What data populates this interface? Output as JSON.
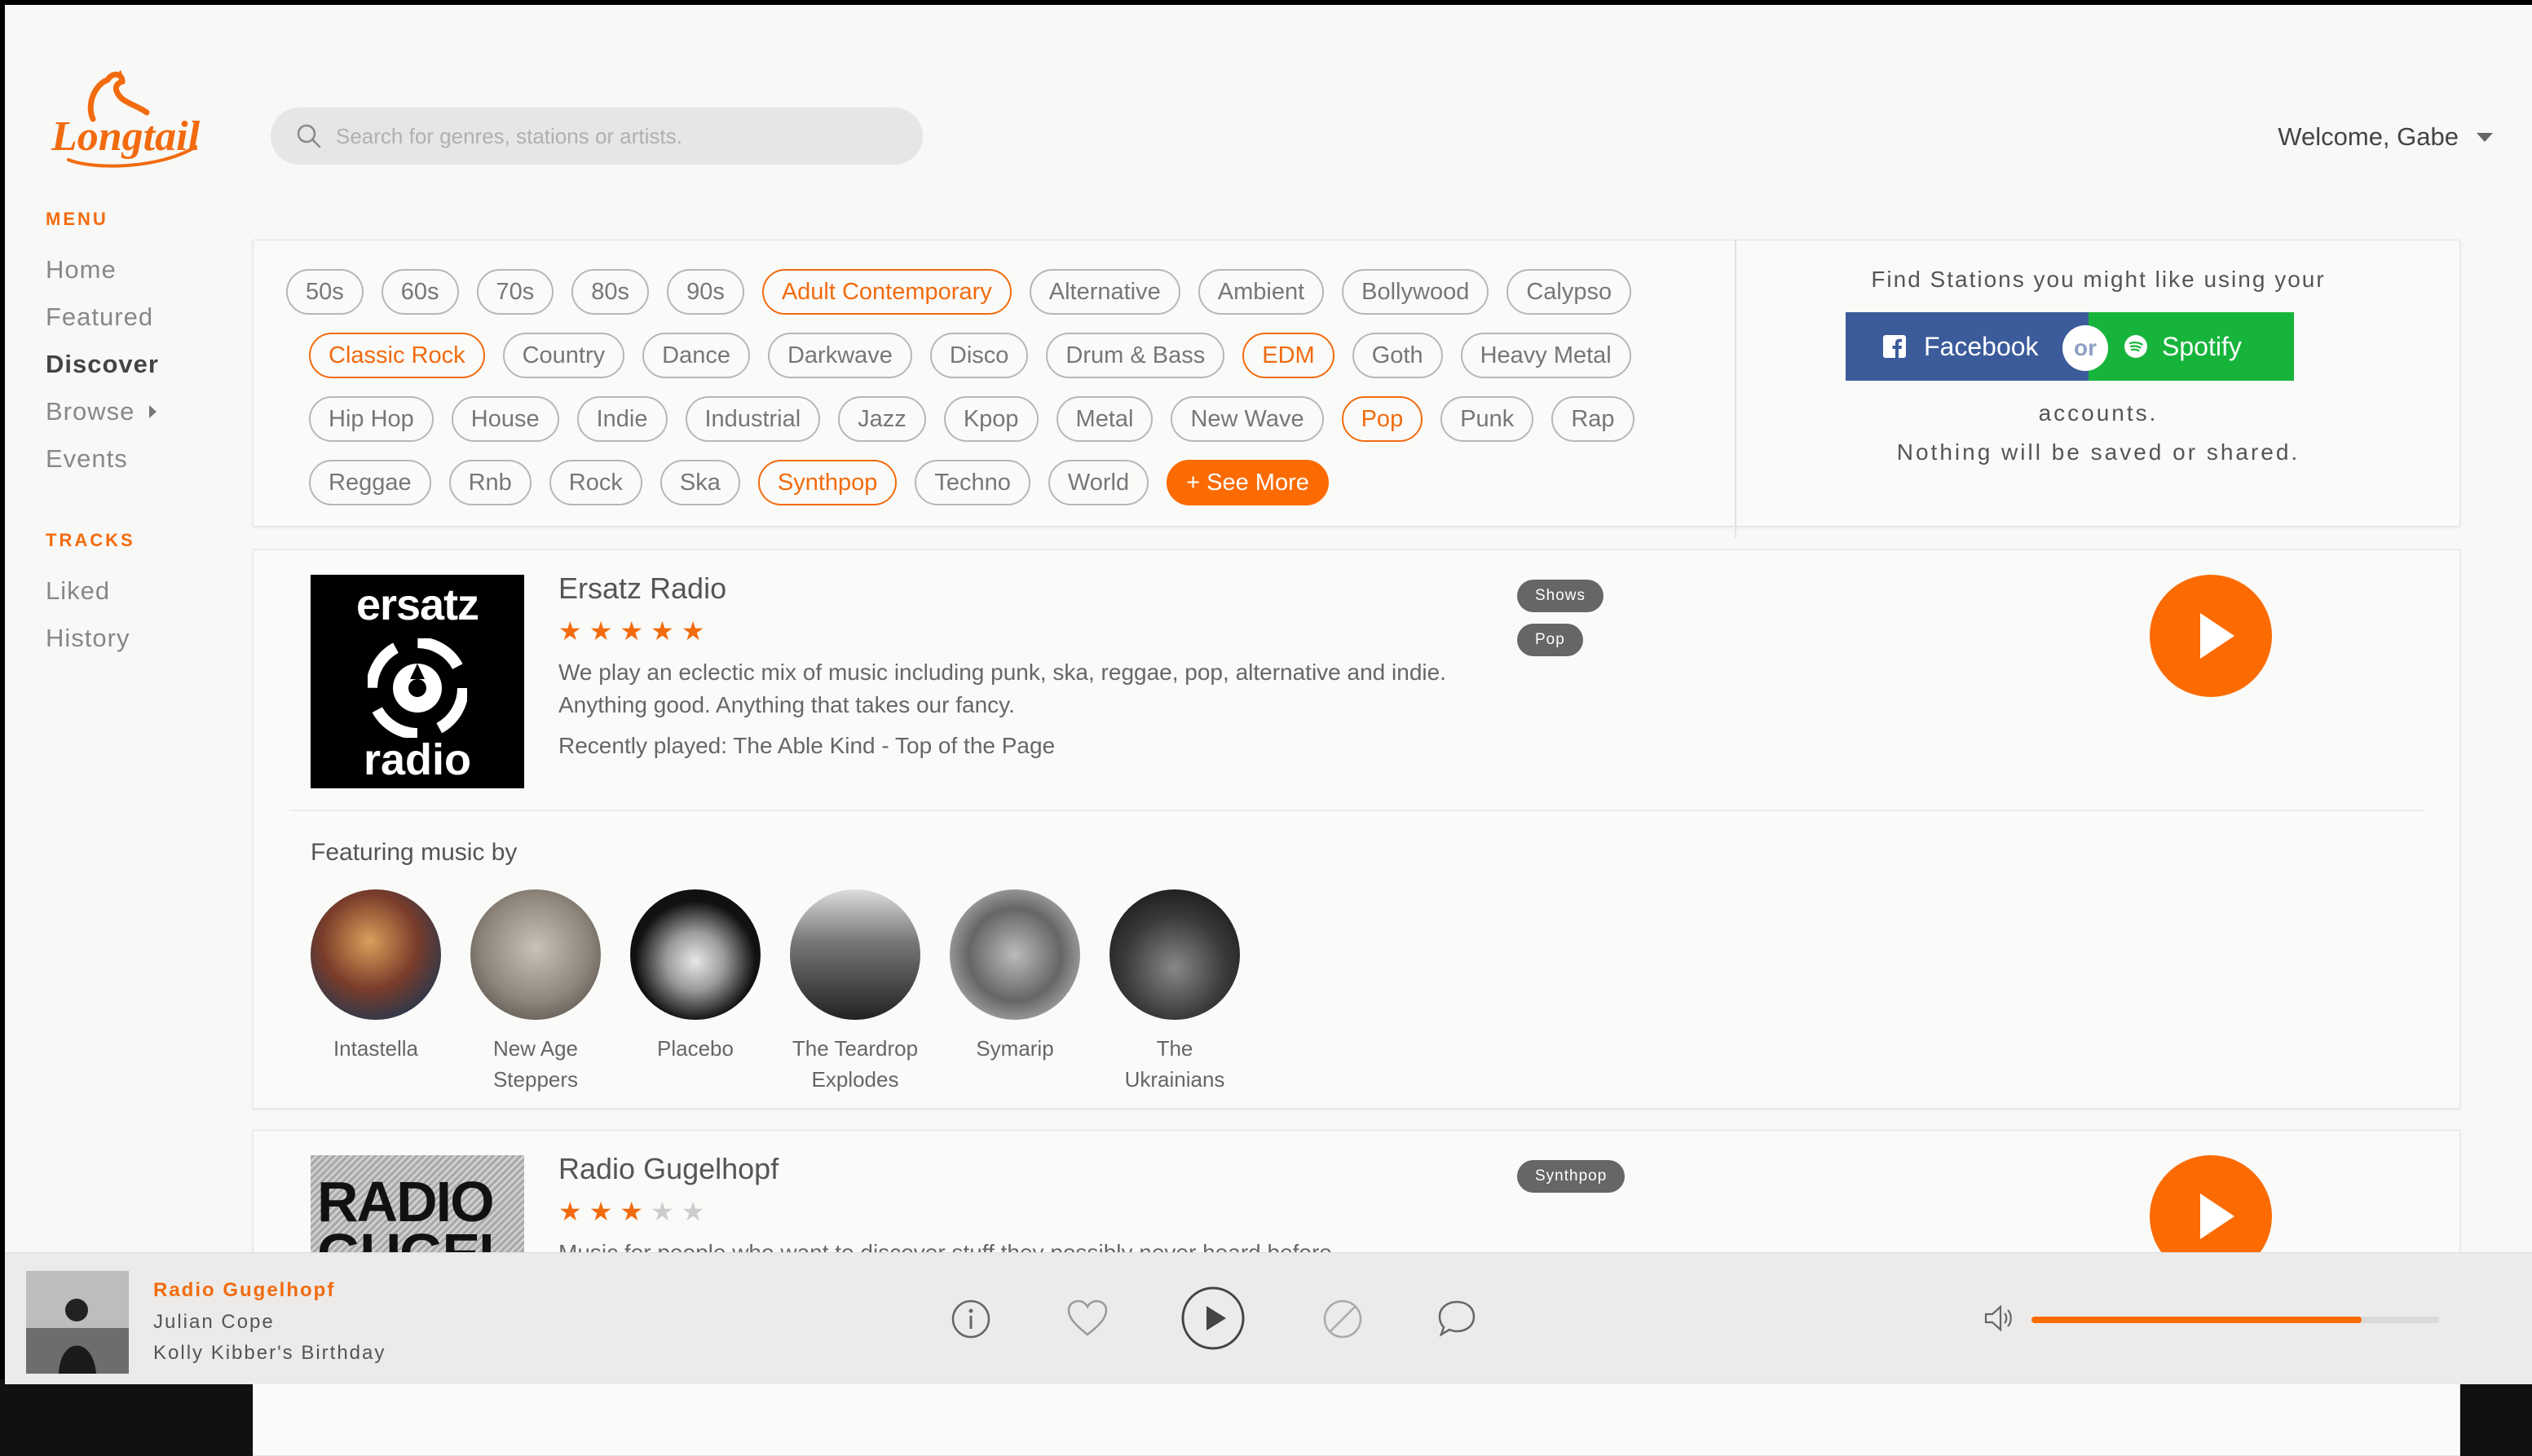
{
  "app": {
    "name": "Longtail"
  },
  "search": {
    "placeholder": "Search for genres, stations or artists."
  },
  "user": {
    "welcome": "Welcome, Gabe"
  },
  "sidebar": {
    "menu_title": "MENU",
    "menu_items": [
      {
        "label": "Home",
        "active": false
      },
      {
        "label": "Featured",
        "active": false
      },
      {
        "label": "Discover",
        "active": true
      },
      {
        "label": "Browse",
        "active": false
      },
      {
        "label": "Events",
        "active": false
      }
    ],
    "tracks_title": "TRACKS",
    "tracks_items": [
      {
        "label": "Liked"
      },
      {
        "label": "History"
      }
    ]
  },
  "genres": {
    "row1": [
      {
        "label": "50s",
        "selected": false
      },
      {
        "label": "60s",
        "selected": false
      },
      {
        "label": "70s",
        "selected": false
      },
      {
        "label": "80s",
        "selected": false
      },
      {
        "label": "90s",
        "selected": false
      },
      {
        "label": "Adult Contemporary",
        "selected": true
      },
      {
        "label": "Alternative",
        "selected": false
      },
      {
        "label": "Ambient",
        "selected": false
      },
      {
        "label": "Bollywood",
        "selected": false
      },
      {
        "label": "Calypso",
        "selected": false
      }
    ],
    "row2": [
      {
        "label": "Classic Rock",
        "selected": true
      },
      {
        "label": "Country",
        "selected": false
      },
      {
        "label": "Dance",
        "selected": false
      },
      {
        "label": "Darkwave",
        "selected": false
      },
      {
        "label": "Disco",
        "selected": false
      },
      {
        "label": "Drum & Bass",
        "selected": false
      },
      {
        "label": "EDM",
        "selected": true
      },
      {
        "label": "Goth",
        "selected": false
      },
      {
        "label": "Heavy Metal",
        "selected": false
      }
    ],
    "row3": [
      {
        "label": "Hip Hop",
        "selected": false
      },
      {
        "label": "House",
        "selected": false
      },
      {
        "label": "Indie",
        "selected": false
      },
      {
        "label": "Industrial",
        "selected": false
      },
      {
        "label": "Jazz",
        "selected": false
      },
      {
        "label": "Kpop",
        "selected": false
      },
      {
        "label": "Metal",
        "selected": false
      },
      {
        "label": "New Wave",
        "selected": false
      },
      {
        "label": "Pop",
        "selected": true
      },
      {
        "label": "Punk",
        "selected": false
      },
      {
        "label": "Rap",
        "selected": false
      }
    ],
    "row4": [
      {
        "label": "Reggae",
        "selected": false
      },
      {
        "label": "Rnb",
        "selected": false
      },
      {
        "label": "Rock",
        "selected": false
      },
      {
        "label": "Ska",
        "selected": false
      },
      {
        "label": "Synthpop",
        "selected": true
      },
      {
        "label": "Techno",
        "selected": false
      },
      {
        "label": "World",
        "selected": false
      }
    ],
    "see_more": "+ See More"
  },
  "social": {
    "line1": "Find Stations you might like using your",
    "facebook": "Facebook",
    "or": "or",
    "spotify": "Spotify",
    "line2": "accounts.",
    "line3": "Nothing will be saved or shared."
  },
  "stations": [
    {
      "name": "Ersatz Radio",
      "rating": 5,
      "art_text_top": "ersatz",
      "art_text_bottom": "radio",
      "description": "We play an eclectic mix of music including punk, ska, reggae, pop, alternative and indie. Anything good. Anything that takes our fancy.",
      "recent": "Recently played: The Able Kind - Top of the Page",
      "tags": [
        "Shows",
        "Pop"
      ],
      "featuring_title": "Featuring music by",
      "artists": [
        {
          "line1": "Intastella",
          "line2": ""
        },
        {
          "line1": "New Age",
          "line2": "Steppers"
        },
        {
          "line1": "Placebo",
          "line2": ""
        },
        {
          "line1": "The Teardrop",
          "line2": "Explodes"
        },
        {
          "line1": "Symarip",
          "line2": ""
        },
        {
          "line1": "The",
          "line2": "Ukrainians"
        }
      ]
    },
    {
      "name": "Radio Gugelhopf",
      "rating": 3,
      "art_text_top": "RADIO",
      "art_text_bottom": "GUGEL",
      "description": "Music for people who want to discover stuff they possibly never heard before.",
      "tags": [
        "Synthpop"
      ]
    }
  ],
  "player": {
    "station": "Radio Gugelhopf",
    "artist": "Julian Cope",
    "track": "Kolly Kibber's Birthday",
    "volume": 0.81
  },
  "colors": {
    "accent": "#fb6b02",
    "facebook": "#3b5b9a",
    "spotify": "#17b43c"
  }
}
